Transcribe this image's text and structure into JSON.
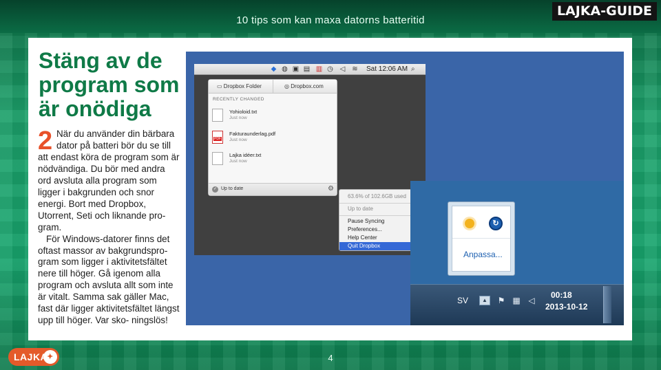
{
  "header": {
    "title": "10 tips som kan maxa datorns batteritid",
    "badge": "LAJKA-GUIDE"
  },
  "article": {
    "heading": "Stäng av de program som är onödiga",
    "step_number": "2",
    "paragraph1_lines": [
      "När du använder din bärbara",
      "dator på batteri bör du se till"
    ],
    "paragraph1_rest": "att endast köra de program som är nödvändiga. Du bör med andra ord avsluta alla program som ligger i bakgrunden och snor energi. Bort med Dropbox, Utorrent, Seti och liknande pro- gram.",
    "paragraph2": "För Windows-datorer finns det oftast massor av bakgrundspro- gram som ligger i aktivitetsfältet nere till höger. Gå igenom alla program och avsluta allt som inte är vitalt. Samma sak gäller Mac, fast där ligger aktivitetsfältet längst upp till höger. Var sko- ningslös!"
  },
  "screenshot": {
    "mac": {
      "clock": "Sat 12:06 AM",
      "icons": [
        "dropbox-icon",
        "flux-icon",
        "chat-icon",
        "skype-icon",
        "battery-icon",
        "time-machine-icon",
        "volume-icon",
        "wifi-icon",
        "search-icon"
      ],
      "panel": {
        "tab1": "Dropbox Folder",
        "tab2": "Dropbox.com",
        "recently_changed": "RECENTLY CHANGED",
        "files": [
          {
            "name": "Yohioloid.txt",
            "time": "Just now"
          },
          {
            "name": "Fakturaunderlag.pdf",
            "time": "Just now"
          },
          {
            "name": "Lajka idéer.txt",
            "time": "Just now"
          }
        ],
        "status": "Up to date"
      },
      "menu": {
        "usage": "63.6% of 102.6GB used",
        "status": "Up to date",
        "items": [
          "Pause Syncing",
          "Preferences...",
          "Help Center",
          "Quit Dropbox"
        ]
      }
    },
    "windows": {
      "customize": "Anpassa...",
      "language": "SV",
      "time": "00:18",
      "date": "2013-10-12"
    }
  },
  "footer": {
    "logo": "LAJKA",
    "page_number": "4"
  },
  "colors": {
    "accent_green": "#0f7a47",
    "accent_orange": "#e8512a",
    "mac_selection": "#3468d6"
  }
}
